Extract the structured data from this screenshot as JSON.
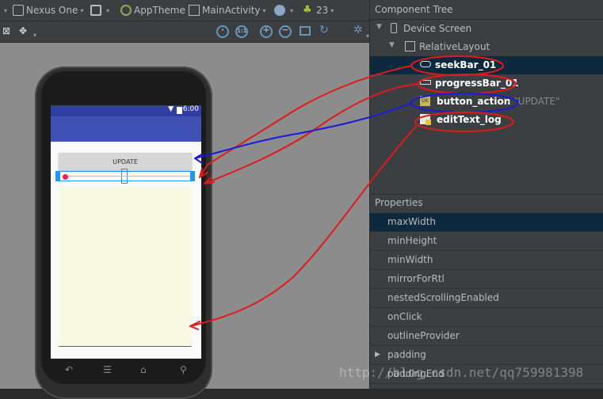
{
  "toolbar": {
    "device": "Nexus One",
    "theme": "AppTheme",
    "activity": "MainActivity",
    "api": "23"
  },
  "phone": {
    "status_time": "6:00",
    "button_label": "UPDATE"
  },
  "component_tree": {
    "title": "Component Tree",
    "items": [
      {
        "label": "Device Screen"
      },
      {
        "label": "RelativeLayout"
      },
      {
        "label": "seekBar_01"
      },
      {
        "label": "progressBar_01"
      },
      {
        "label": "button_action",
        "suffix": "- \"UPDATE\""
      },
      {
        "label": "editText_log"
      }
    ]
  },
  "properties": {
    "title": "Properties",
    "rows": [
      "maxWidth",
      "minHeight",
      "minWidth",
      "mirrorForRtl",
      "nestedScrollingEnabled",
      "onClick",
      "outlineProvider",
      "padding",
      "paddingEnd"
    ]
  },
  "watermark": "http://blog.csdn.net/qq759981398",
  "colors": {
    "annotation_red": "#e0191b",
    "annotation_blue": "#1a1ad8",
    "selection": "#0d293e"
  }
}
